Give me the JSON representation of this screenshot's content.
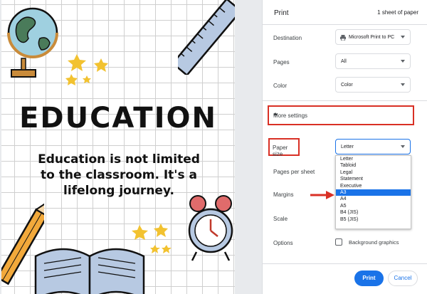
{
  "poster": {
    "title": "EDUCATION",
    "body_lines": [
      "Education is not limited",
      "to the classroom. It's a",
      "lifelong journey."
    ]
  },
  "panel": {
    "title": "Print",
    "sheets": "1 sheet of paper",
    "destination": {
      "label": "Destination",
      "value": "Microsoft Print to PC"
    },
    "pages": {
      "label": "Pages",
      "value": "All"
    },
    "color": {
      "label": "Color",
      "value": "Color"
    },
    "more_settings": "More settings",
    "paper_size": {
      "label": "Paper size",
      "value": "Letter"
    },
    "pages_per_sheet": {
      "label": "Pages per sheet"
    },
    "margins": {
      "label": "Margins"
    },
    "scale": {
      "label": "Scale"
    },
    "options": {
      "label": "Options",
      "checkbox_label": "Background graphics"
    },
    "print_button": "Print",
    "cancel_button": "Cancel"
  },
  "paper_size_options": [
    "Letter",
    "Tabloid",
    "Legal",
    "Statement",
    "Executive",
    "A3",
    "A4",
    "A5",
    "B4 (JIS)",
    "B5 (JIS)"
  ],
  "paper_size_highlighted": "A3",
  "colors": {
    "accent": "#1a73e8",
    "annotation_red": "#d93025"
  }
}
